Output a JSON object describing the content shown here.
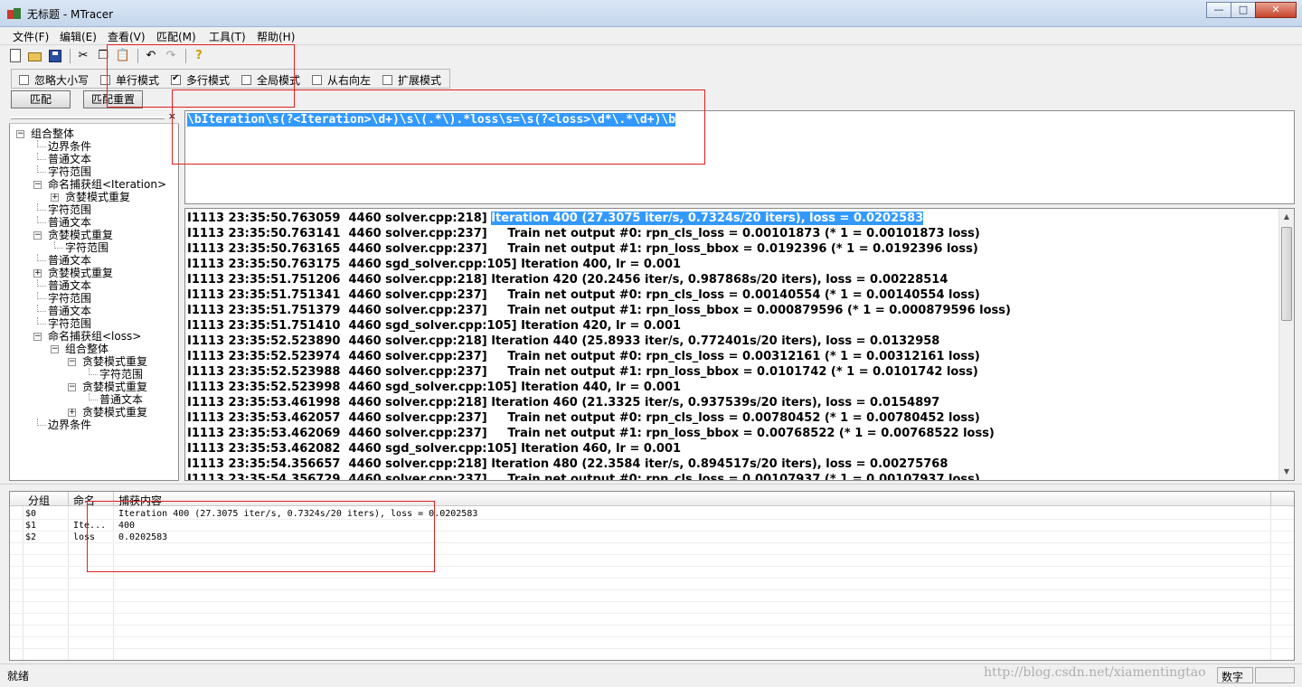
{
  "window": {
    "title": "无标题 - MTracer",
    "controls": {
      "minimize": "—",
      "maximize": "□",
      "close": "✕"
    }
  },
  "menu": [
    "文件(F)",
    "编辑(E)",
    "查看(V)",
    "匹配(M)",
    "工具(T)",
    "帮助(H)"
  ],
  "toolbar": {
    "icons": [
      "new-file-icon",
      "open-folder-icon",
      "save-icon",
      "cut-icon",
      "copy-icon",
      "paste-icon",
      "undo-icon",
      "redo-icon",
      "help-icon"
    ]
  },
  "options": [
    {
      "label": "忽略大小写",
      "checked": false
    },
    {
      "label": "单行模式",
      "checked": false
    },
    {
      "label": "多行模式",
      "checked": true
    },
    {
      "label": "全局模式",
      "checked": false
    },
    {
      "label": "从右向左",
      "checked": false
    },
    {
      "label": "扩展模式",
      "checked": false
    }
  ],
  "buttons": {
    "match": "匹配",
    "reset": "匹配重置"
  },
  "tree": {
    "close": "×",
    "nodes": [
      {
        "label": "组合整体",
        "level": 0,
        "toggle": "-"
      },
      {
        "label": "边界条件",
        "level": 1,
        "toggle": ""
      },
      {
        "label": "普通文本",
        "level": 1,
        "toggle": ""
      },
      {
        "label": "字符范围",
        "level": 1,
        "toggle": ""
      },
      {
        "label": "命名捕获组<Iteration>",
        "level": 1,
        "toggle": "-"
      },
      {
        "label": "贪婪模式重复",
        "level": 2,
        "toggle": "+"
      },
      {
        "label": "字符范围",
        "level": 1,
        "toggle": ""
      },
      {
        "label": "普通文本",
        "level": 1,
        "toggle": ""
      },
      {
        "label": "贪婪模式重复",
        "level": 1,
        "toggle": "-"
      },
      {
        "label": "字符范围",
        "level": 2,
        "toggle": ""
      },
      {
        "label": "普通文本",
        "level": 1,
        "toggle": ""
      },
      {
        "label": "贪婪模式重复",
        "level": 1,
        "toggle": "+"
      },
      {
        "label": "普通文本",
        "level": 1,
        "toggle": ""
      },
      {
        "label": "字符范围",
        "level": 1,
        "toggle": ""
      },
      {
        "label": "普通文本",
        "level": 1,
        "toggle": ""
      },
      {
        "label": "字符范围",
        "level": 1,
        "toggle": ""
      },
      {
        "label": "命名捕获组<loss>",
        "level": 1,
        "toggle": "-"
      },
      {
        "label": "组合整体",
        "level": 2,
        "toggle": "-"
      },
      {
        "label": "贪婪模式重复",
        "level": 3,
        "toggle": "-"
      },
      {
        "label": "字符范围",
        "level": 4,
        "toggle": ""
      },
      {
        "label": "贪婪模式重复",
        "level": 3,
        "toggle": "-"
      },
      {
        "label": "普通文本",
        "level": 4,
        "toggle": ""
      },
      {
        "label": "贪婪模式重复",
        "level": 3,
        "toggle": "+"
      },
      {
        "label": "边界条件",
        "level": 1,
        "toggle": ""
      }
    ]
  },
  "regex": "\\bIteration\\s(?<Iteration>\\d+)\\s\\(.*\\).*loss\\s=\\s(?<loss>\\d*\\.*\\d+)\\b",
  "log": {
    "lines": [
      {
        "prefix": "I1113 23:35:50.763059  4460 solver.cpp:218] ",
        "highlight": "Iteration 400 (27.3075 iter/s, 0.7324s/20 iters), loss = 0.0202583"
      },
      {
        "prefix": "I1113 23:35:50.763141  4460 solver.cpp:237]     Train net output #0: rpn_cls_loss = 0.00101873 (* 1 = 0.00101873 loss)",
        "highlight": ""
      },
      {
        "prefix": "I1113 23:35:50.763165  4460 solver.cpp:237]     Train net output #1: rpn_loss_bbox = 0.0192396 (* 1 = 0.0192396 loss)",
        "highlight": ""
      },
      {
        "prefix": "I1113 23:35:50.763175  4460 sgd_solver.cpp:105] Iteration 400, lr = 0.001",
        "highlight": ""
      },
      {
        "prefix": "I1113 23:35:51.751206  4460 solver.cpp:218] Iteration 420 (20.2456 iter/s, 0.987868s/20 iters), loss = 0.00228514",
        "highlight": ""
      },
      {
        "prefix": "I1113 23:35:51.751341  4460 solver.cpp:237]     Train net output #0: rpn_cls_loss = 0.00140554 (* 1 = 0.00140554 loss)",
        "highlight": ""
      },
      {
        "prefix": "I1113 23:35:51.751379  4460 solver.cpp:237]     Train net output #1: rpn_loss_bbox = 0.000879596 (* 1 = 0.000879596 loss)",
        "highlight": ""
      },
      {
        "prefix": "I1113 23:35:51.751410  4460 sgd_solver.cpp:105] Iteration 420, lr = 0.001",
        "highlight": ""
      },
      {
        "prefix": "I1113 23:35:52.523890  4460 solver.cpp:218] Iteration 440 (25.8933 iter/s, 0.772401s/20 iters), loss = 0.0132958",
        "highlight": ""
      },
      {
        "prefix": "I1113 23:35:52.523974  4460 solver.cpp:237]     Train net output #0: rpn_cls_loss = 0.00312161 (* 1 = 0.00312161 loss)",
        "highlight": ""
      },
      {
        "prefix": "I1113 23:35:52.523988  4460 solver.cpp:237]     Train net output #1: rpn_loss_bbox = 0.0101742 (* 1 = 0.0101742 loss)",
        "highlight": ""
      },
      {
        "prefix": "I1113 23:35:52.523998  4460 sgd_solver.cpp:105] Iteration 440, lr = 0.001",
        "highlight": ""
      },
      {
        "prefix": "I1113 23:35:53.461998  4460 solver.cpp:218] Iteration 460 (21.3325 iter/s, 0.937539s/20 iters), loss = 0.0154897",
        "highlight": ""
      },
      {
        "prefix": "I1113 23:35:53.462057  4460 solver.cpp:237]     Train net output #0: rpn_cls_loss = 0.00780452 (* 1 = 0.00780452 loss)",
        "highlight": ""
      },
      {
        "prefix": "I1113 23:35:53.462069  4460 solver.cpp:237]     Train net output #1: rpn_loss_bbox = 0.00768522 (* 1 = 0.00768522 loss)",
        "highlight": ""
      },
      {
        "prefix": "I1113 23:35:53.462082  4460 sgd_solver.cpp:105] Iteration 460, lr = 0.001",
        "highlight": ""
      },
      {
        "prefix": "I1113 23:35:54.356657  4460 solver.cpp:218] Iteration 480 (22.3584 iter/s, 0.894517s/20 iters), loss = 0.00275768",
        "highlight": ""
      },
      {
        "prefix": "I1113 23:35:54.356729  4460 solver.cpp:237]     Train net output #0: rpn_cls_loss = 0.00107937 (* 1 = 0.00107937 loss)",
        "highlight": ""
      }
    ]
  },
  "results": {
    "columns": [
      "分组",
      "命名",
      "捕获内容"
    ],
    "rows": [
      {
        "group": "$0",
        "name": "",
        "content": "Iteration 400 (27.3075 iter/s, 0.7324s/20 iters), loss = 0.0202583"
      },
      {
        "group": "$1",
        "name": "Ite...",
        "content": "400"
      },
      {
        "group": "$2",
        "name": "loss",
        "content": "0.0202583"
      }
    ]
  },
  "status": {
    "text": "就绪",
    "mode": "数字"
  },
  "watermark": "http://blog.csdn.net/xiamentingtao",
  "colors": {
    "selection": "#3399ff",
    "annotation": "#e02020"
  }
}
